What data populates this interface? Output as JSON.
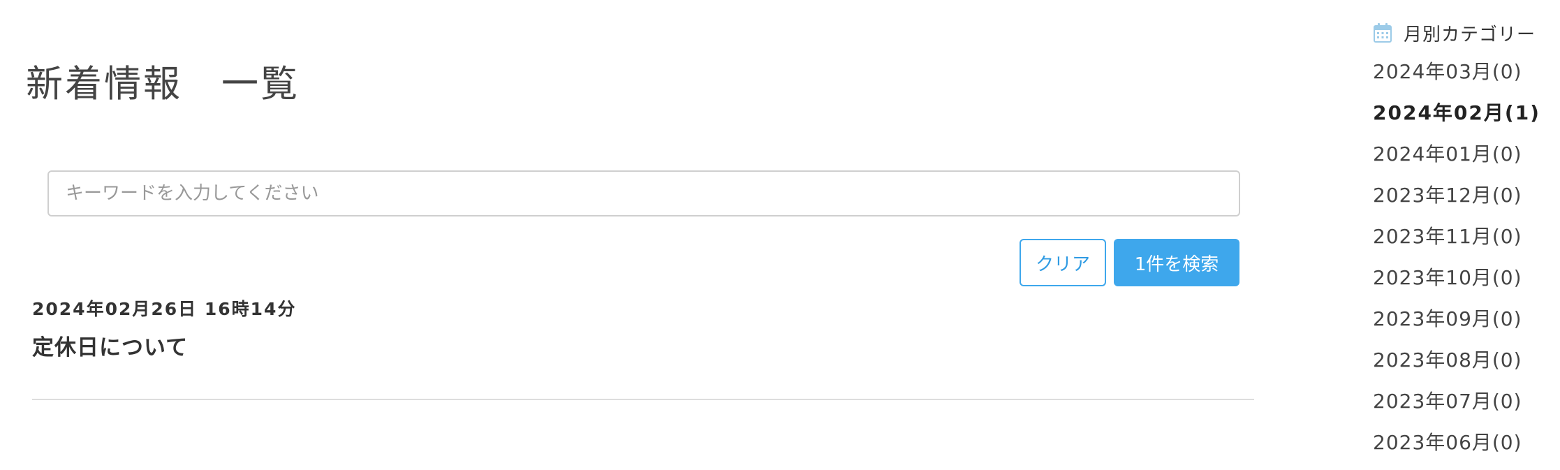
{
  "page": {
    "title": "新着情報　一覧"
  },
  "search": {
    "placeholder": "キーワードを入力してください",
    "value": "",
    "clear_label": "クリア",
    "submit_label": "1件を検索"
  },
  "posts": [
    {
      "date": "2024年02月26日 16時14分",
      "title": "定休日について"
    }
  ],
  "sidebar": {
    "title": "月別カテゴリー",
    "icon": "calendar-icon",
    "months": [
      {
        "label": "2024年03月(0)",
        "active": false
      },
      {
        "label": "2024年02月(1)",
        "active": true
      },
      {
        "label": "2024年01月(0)",
        "active": false
      },
      {
        "label": "2023年12月(0)",
        "active": false
      },
      {
        "label": "2023年11月(0)",
        "active": false
      },
      {
        "label": "2023年10月(0)",
        "active": false
      },
      {
        "label": "2023年09月(0)",
        "active": false
      },
      {
        "label": "2023年08月(0)",
        "active": false
      },
      {
        "label": "2023年07月(0)",
        "active": false
      },
      {
        "label": "2023年06月(0)",
        "active": false
      }
    ]
  },
  "colors": {
    "accent": "#3ea7ec",
    "text": "#333333",
    "icon": "#9ccbe8"
  }
}
